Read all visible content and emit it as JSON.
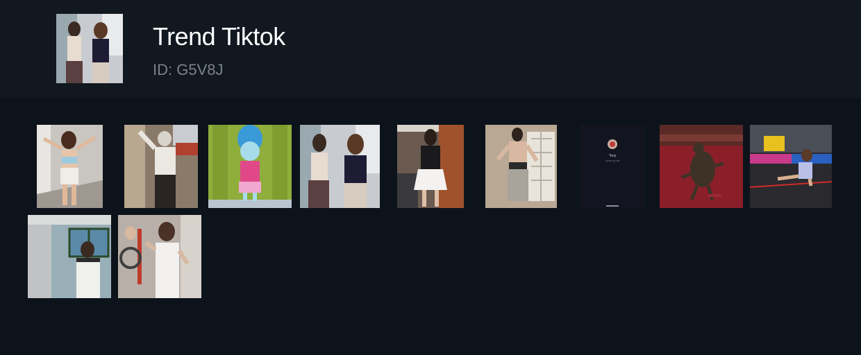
{
  "header": {
    "title": "Trend Tiktok",
    "id_text": "ID: G5V8J",
    "cover_icon": "video-thumbnail-two-dancers"
  },
  "videos": [
    {
      "name": "video-thumbnail-girl-posing",
      "bg": "#c9c6c1"
    },
    {
      "name": "video-thumbnail-grandma-dancing",
      "bg": "#8a7a6a"
    },
    {
      "name": "video-thumbnail-cartoon-character",
      "bg": "#8fae3c"
    },
    {
      "name": "video-thumbnail-two-dancers",
      "bg": "#c8ccd0"
    },
    {
      "name": "video-thumbnail-girl-garage",
      "bg": "#6a5a50"
    },
    {
      "name": "video-thumbnail-man-dancing",
      "bg": "#b8a894"
    },
    {
      "name": "video-thumbnail-phone-call",
      "bg": "#12141f"
    },
    {
      "name": "video-thumbnail-dog-red-carpet",
      "bg": "#8a1f2a"
    },
    {
      "name": "video-thumbnail-kid-trampoline",
      "bg": "#2a2a2e"
    },
    {
      "name": "video-thumbnail-chef",
      "bg": "#9ab0b8"
    },
    {
      "name": "video-thumbnail-man-apron",
      "bg": "#b8b0a8"
    }
  ],
  "phone_call": {
    "caller": "Tony",
    "subtitle": "Incoming call"
  },
  "colors": {
    "background": "#0d131a",
    "header": "#111820",
    "title": "#ffffff",
    "id": "#7b828a"
  }
}
